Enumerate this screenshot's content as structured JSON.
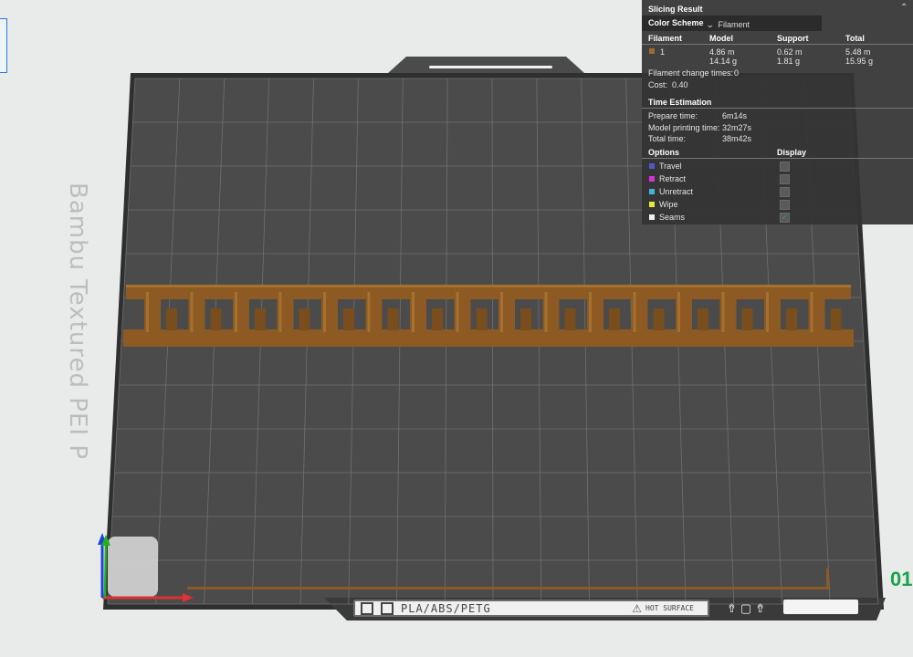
{
  "plate": {
    "label": "Bambu Textured PEI P",
    "material": "PLA/ABS/PETG",
    "hot_text": "HOT SURFACE"
  },
  "right_edge_text": "01",
  "panel": {
    "title": "Slicing Result",
    "color_scheme_label": "Color Scheme",
    "color_scheme_value": "Filament",
    "headers": {
      "filament": "Filament",
      "model": "Model",
      "support": "Support",
      "total": "Total"
    },
    "filament_rows": [
      {
        "id": "1",
        "color": "#a06a2e",
        "model_length": "4.86 m",
        "model_weight": "14.14 g",
        "support_length": "0.62 m",
        "support_weight": "1.81 g",
        "total_length": "5.48 m",
        "total_weight": "15.95 g"
      }
    ],
    "filament_change_label": "Filament change times:",
    "filament_change_value": "0",
    "cost_label": "Cost:",
    "cost_value": "0.40",
    "time_title": "Time Estimation",
    "times": [
      {
        "label": "Prepare time:",
        "value": "6m14s"
      },
      {
        "label": "Model printing time:",
        "value": "32m27s"
      },
      {
        "label": "Total time:",
        "value": "38m42s"
      }
    ],
    "options_header": "Options",
    "display_header": "Display",
    "options": [
      {
        "label": "Travel",
        "color": "#4f58c8",
        "checked": false
      },
      {
        "label": "Retract",
        "color": "#d335d3",
        "checked": false
      },
      {
        "label": "Unretract",
        "color": "#3fb6d8",
        "checked": false
      },
      {
        "label": "Wipe",
        "color": "#e8e83a",
        "checked": false
      },
      {
        "label": "Seams",
        "color": "#f0f0f0",
        "checked": true
      }
    ]
  },
  "colors": {
    "plate": "#4b4b4b",
    "plate_edge": "#2f2f2f",
    "grid": "#707070",
    "model": "#8c5a22",
    "axis_x": "#e03030",
    "axis_y": "#20b020",
    "axis_z": "#2040e0"
  }
}
